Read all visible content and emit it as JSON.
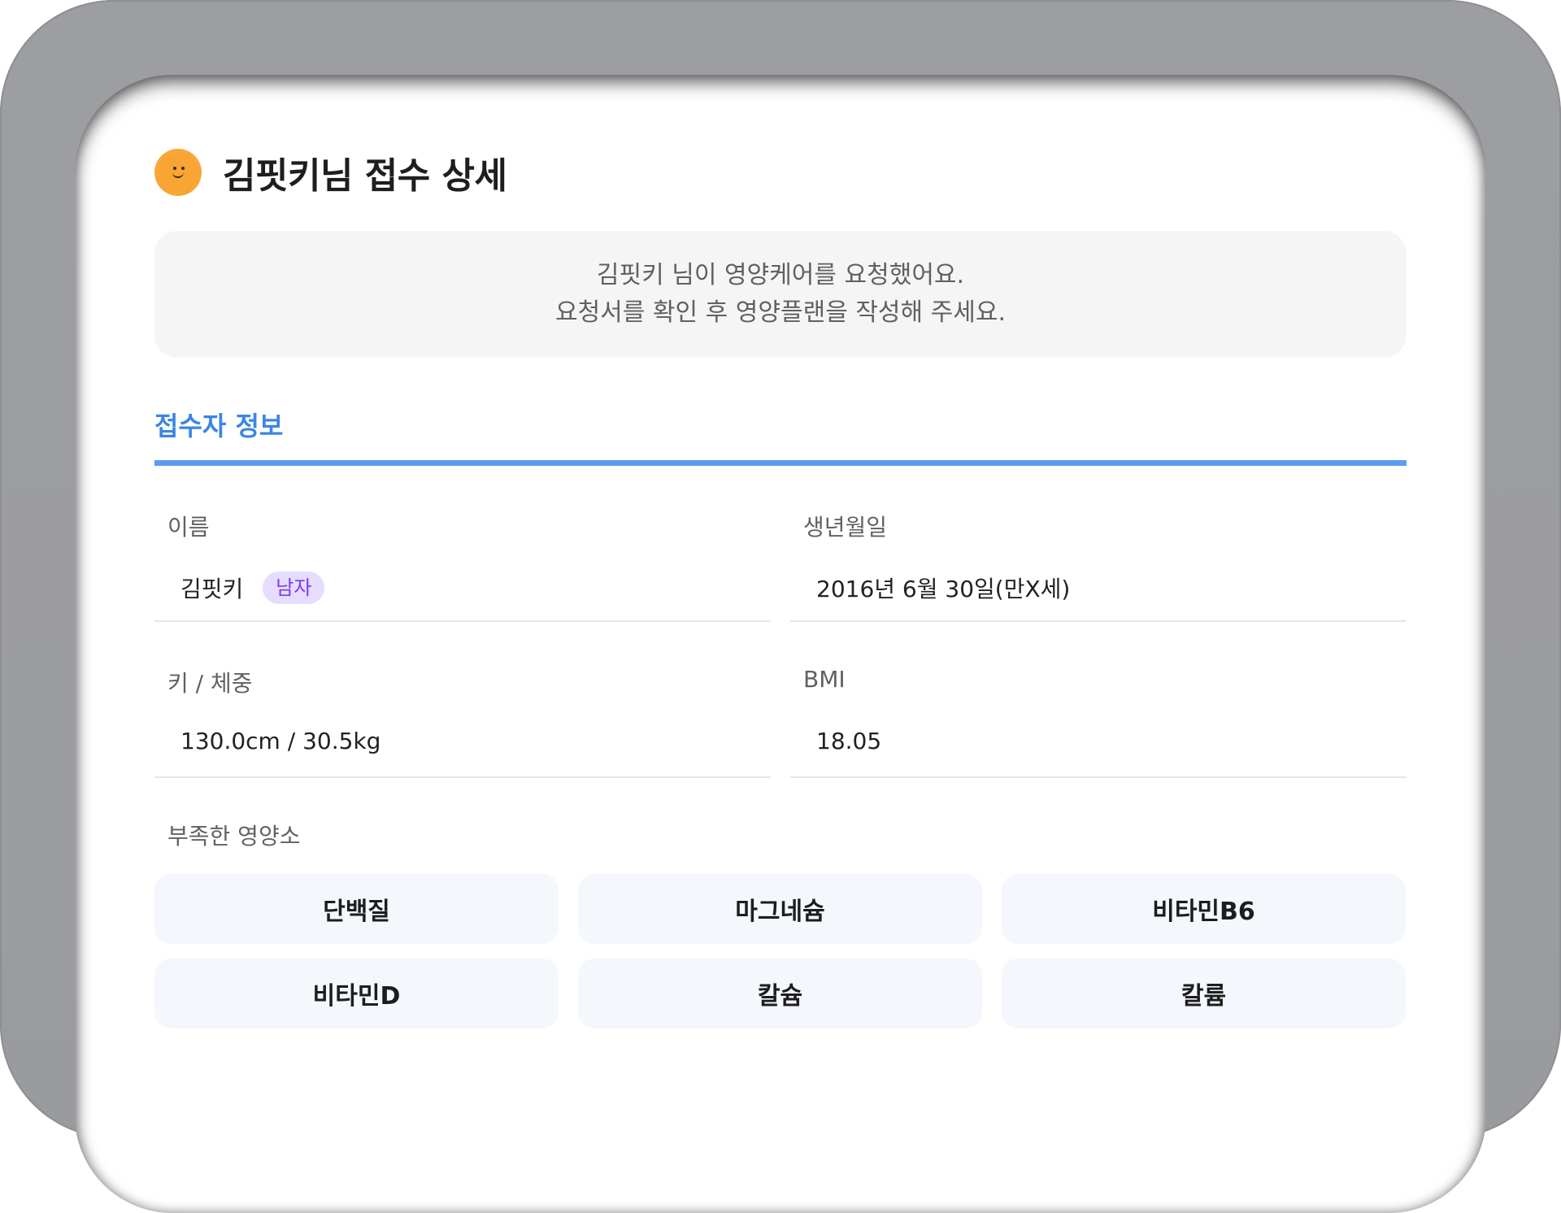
{
  "page": {
    "title": "김핏키님 접수 상세"
  },
  "notice": {
    "line1": "김핏키 님이 영양케어를 요청했어요.",
    "line2": "요청서를 확인 후 영양플랜을 작성해 주세요."
  },
  "section": {
    "title": "접수자 정보"
  },
  "fields": {
    "name": {
      "label": "이름",
      "value": "김핏키",
      "gender": "남자"
    },
    "birth": {
      "label": "생년월일",
      "value": "2016년 6월 30일(만X세)"
    },
    "body": {
      "label": "키 / 체중",
      "value": "130.0cm / 30.5kg"
    },
    "bmi": {
      "label": "BMI",
      "value": "18.05"
    }
  },
  "nutrients": {
    "label": "부족한 영양소",
    "items": [
      "단백질",
      "마그네슘",
      "비타민B6",
      "비타민D",
      "칼슘",
      "칼륨"
    ]
  },
  "colors": {
    "accent": "#3b86e3",
    "badge_bg": "#e6dcff",
    "badge_text": "#7c3aed"
  }
}
